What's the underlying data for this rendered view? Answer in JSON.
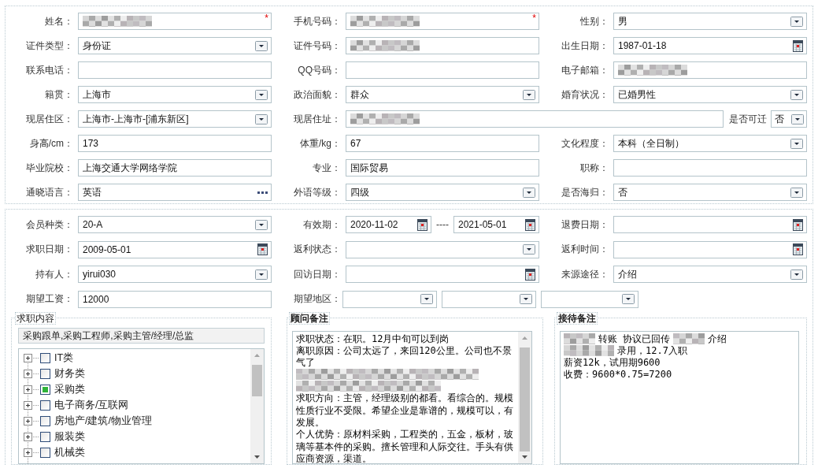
{
  "profile": {
    "fields": [
      {
        "label": "姓名：",
        "kind": "redacted",
        "marker": "*"
      },
      {
        "label": "手机号码：",
        "kind": "redacted",
        "marker": "*"
      },
      {
        "label": "性别：",
        "kind": "select",
        "value": "男"
      },
      {
        "label": "证件类型：",
        "kind": "select",
        "value": "身份证"
      },
      {
        "label": "证件号码：",
        "kind": "redacted"
      },
      {
        "label": "出生日期：",
        "kind": "date",
        "value": "1987-01-18"
      },
      {
        "label": "联系电话：",
        "kind": "text"
      },
      {
        "label": "QQ号码：",
        "kind": "text"
      },
      {
        "label": "电子邮箱：",
        "kind": "redacted"
      },
      {
        "label": "籍贯：",
        "kind": "select",
        "value": "上海市"
      },
      {
        "label": "政治面貌：",
        "kind": "select",
        "value": "群众"
      },
      {
        "label": "婚育状况：",
        "kind": "select",
        "value": "已婚男性"
      },
      {
        "label": "现居住区：",
        "kind": "select",
        "value": "上海市-上海市-[浦东新区]"
      },
      {
        "label": "现居住址：",
        "kind": "redacted",
        "extra": {
          "label": "是否可迁",
          "kind": "select",
          "value": "否"
        }
      },
      {
        "label": "身高/cm：",
        "kind": "text",
        "value": "173"
      },
      {
        "label": "体重/kg：",
        "kind": "text",
        "value": "67"
      },
      {
        "label": "文化程度：",
        "kind": "select",
        "value": "本科（全日制）"
      },
      {
        "label": "毕业院校：",
        "kind": "text",
        "value": "上海交通大学网络学院"
      },
      {
        "label": "专业：",
        "kind": "text",
        "value": "国际贸易"
      },
      {
        "label": "职称：",
        "kind": "text"
      },
      {
        "label": "通晓语言：",
        "kind": "lookup",
        "value": "英语"
      },
      {
        "label": "外语等级：",
        "kind": "select",
        "value": "四级"
      },
      {
        "label": "是否海归：",
        "kind": "select",
        "value": "否"
      }
    ]
  },
  "membership": {
    "fields": [
      {
        "label": "会员种类：",
        "kind": "select",
        "value": "20-A"
      },
      {
        "label": "有效期：",
        "kind": "daterange",
        "values": [
          "2020-11-02",
          "2021-05-01"
        ],
        "separator": "----"
      },
      {
        "label": "退费日期：",
        "kind": "date"
      },
      {
        "label": "求职日期：",
        "kind": "date",
        "value": "2009-05-01"
      },
      {
        "label": "返利状态：",
        "kind": "select"
      },
      {
        "label": "返利时间：",
        "kind": "date"
      },
      {
        "label": "持有人：",
        "kind": "select",
        "value": "yirui030"
      },
      {
        "label": "回访日期：",
        "kind": "date"
      },
      {
        "label": "来源途径：",
        "kind": "select",
        "value": "介绍"
      },
      {
        "label": "期望工资：",
        "kind": "text",
        "value": "12000"
      },
      {
        "label": "期望地区：",
        "kind": "region"
      }
    ]
  },
  "job_content": {
    "title": "求职内容",
    "summary": "采购跟单,采购工程师,采购主管/经理/总监",
    "categories": [
      {
        "label": "IT类",
        "checked": false,
        "expanded": false
      },
      {
        "label": "财务类",
        "checked": false,
        "expanded": false
      },
      {
        "label": "采购类",
        "checked": true,
        "expanded": false
      },
      {
        "label": "电子商务/互联网",
        "checked": false,
        "expanded": false
      },
      {
        "label": "房地产/建筑/物业管理",
        "checked": false,
        "expanded": false
      },
      {
        "label": "服装类",
        "checked": false,
        "expanded": false
      },
      {
        "label": "机械类",
        "checked": false,
        "expanded": false
      }
    ]
  },
  "consultant_notes": {
    "title": "顾问备注",
    "lines": [
      {
        "kind": "text",
        "text": "求职状态：在职。12月中旬可以到岗"
      },
      {
        "kind": "text",
        "text": "离职原因：公司太远了，来回120公里。公司也不景气了"
      },
      {
        "kind": "redacted"
      },
      {
        "kind": "redacted"
      },
      {
        "kind": "text",
        "text": "求职方向：主管，经理级别的都看。看综合的。规模性质行业不受限。希望企业是靠谱的，规模可以，有发展。"
      },
      {
        "kind": "text",
        "text": "个人优势：原材料采购，工程类的，五金，板材，玻璃等基本件的采购。擅长管理和人际交往。手头有供应商资源，渠道。"
      }
    ]
  },
  "reception_notes": {
    "title": "接待备注",
    "lines": [
      [
        {
          "kind": "redacted"
        },
        {
          "kind": "text",
          "text": "转账 协议已回传"
        },
        {
          "kind": "redacted"
        },
        {
          "kind": "text",
          "text": "介绍"
        }
      ],
      [
        {
          "kind": "redacted"
        },
        {
          "kind": "text",
          "text": "录用，12.7入职"
        }
      ],
      [
        {
          "kind": "text",
          "text": "薪资12k，试用期9600"
        }
      ],
      [
        {
          "kind": "text",
          "text": "收费：9600*0.75=7200"
        }
      ]
    ]
  }
}
